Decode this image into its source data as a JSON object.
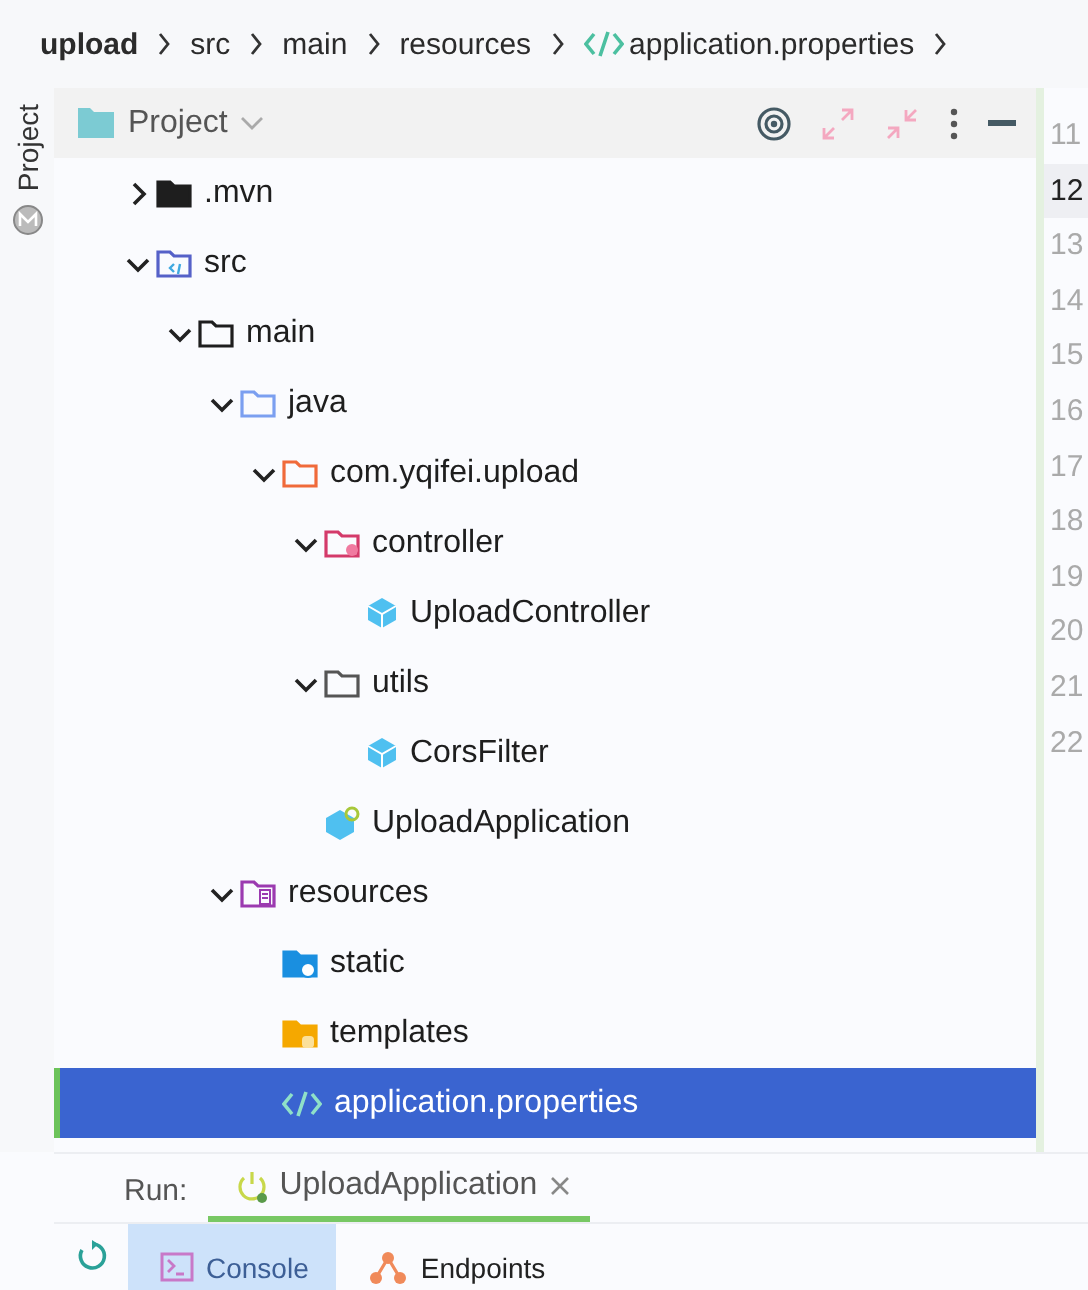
{
  "breadcrumbs": [
    {
      "label": "upload",
      "kind": "module"
    },
    {
      "label": "src",
      "kind": "folder"
    },
    {
      "label": "main",
      "kind": "folder"
    },
    {
      "label": "resources",
      "kind": "folder"
    },
    {
      "label": "application.properties",
      "kind": "properties"
    }
  ],
  "side_strip": {
    "label": "Project"
  },
  "project_panel": {
    "title": "Project"
  },
  "tree": [
    {
      "label": ".mvn",
      "kind": "folder",
      "expanded": false,
      "selected": false
    },
    {
      "label": "src",
      "kind": "source-root",
      "expanded": true,
      "selected": false,
      "children": [
        {
          "label": "main",
          "kind": "folder-dark-outline",
          "expanded": true,
          "selected": false,
          "children": [
            {
              "label": "java",
              "kind": "java-root",
              "expanded": true,
              "selected": false,
              "children": [
                {
                  "label": "com.yqifei.upload",
                  "kind": "package",
                  "expanded": true,
                  "selected": false,
                  "children": [
                    {
                      "label": "controller",
                      "kind": "controller-folder",
                      "expanded": true,
                      "selected": false,
                      "children": [
                        {
                          "label": "UploadController",
                          "kind": "class",
                          "selected": false
                        }
                      ]
                    },
                    {
                      "label": "utils",
                      "kind": "folder-outline",
                      "expanded": true,
                      "selected": false,
                      "children": [
                        {
                          "label": "CorsFilter",
                          "kind": "class",
                          "selected": false
                        }
                      ]
                    },
                    {
                      "label": "UploadApplication",
                      "kind": "spring-app",
                      "selected": false
                    }
                  ]
                }
              ]
            },
            {
              "label": "resources",
              "kind": "resources-root",
              "expanded": true,
              "selected": false,
              "children": [
                {
                  "label": "static",
                  "kind": "web-folder",
                  "selected": false
                },
                {
                  "label": "templates",
                  "kind": "template-folder",
                  "selected": false
                },
                {
                  "label": "application.properties",
                  "kind": "properties",
                  "selected": true
                }
              ]
            }
          ]
        }
      ]
    }
  ],
  "gutter": [
    {
      "line": "11",
      "current": false
    },
    {
      "line": "12",
      "current": true
    },
    {
      "line": "13",
      "current": false
    },
    {
      "line": "14",
      "current": false
    },
    {
      "line": "15",
      "current": false
    },
    {
      "line": "16",
      "current": false
    },
    {
      "line": "17",
      "current": false
    },
    {
      "line": "18",
      "current": false
    },
    {
      "line": "19",
      "current": false
    },
    {
      "line": "20",
      "current": false
    },
    {
      "line": "21",
      "current": false
    },
    {
      "line": "22",
      "current": false
    }
  ],
  "run_bar": {
    "label": "Run:",
    "tabs": [
      {
        "label": "UploadApplication",
        "selected": true
      }
    ]
  },
  "run_tools": [
    {
      "label": "Console",
      "kind": "console",
      "selected": true
    },
    {
      "label": "Endpoints",
      "kind": "endpoints",
      "selected": false
    }
  ]
}
